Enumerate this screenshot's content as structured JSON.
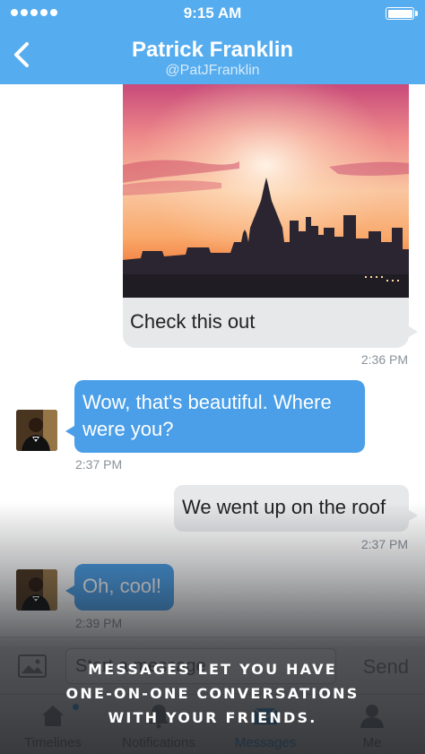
{
  "status_bar": {
    "time": "9:15 AM",
    "signal_dots": 5,
    "battery_level": 1.0
  },
  "header": {
    "title": "Patrick Franklin",
    "handle": "@PatJFranklin"
  },
  "messages": [
    {
      "direction": "outgoing",
      "type": "photo",
      "caption": "Check this out",
      "time": "2:36 PM"
    },
    {
      "direction": "incoming",
      "type": "text",
      "lines": [
        "Wow, that's beautiful. Where",
        "were you?"
      ],
      "time": "2:37 PM"
    },
    {
      "direction": "outgoing",
      "type": "text",
      "text": "We went up on the roof",
      "time": "2:37 PM"
    },
    {
      "direction": "incoming",
      "type": "text",
      "text": "Oh, cool!",
      "time": "2:39 PM"
    }
  ],
  "compose": {
    "placeholder": "Start a message",
    "send_label": "Send",
    "icon": "camera-icon"
  },
  "tabs": [
    {
      "label": "Timelines",
      "icon": "home-icon",
      "active": false,
      "has_notification_dot": true
    },
    {
      "label": "Notifications",
      "icon": "bell-icon",
      "active": false
    },
    {
      "label": "Messages",
      "icon": "envelope-icon",
      "active": true
    },
    {
      "label": "Me",
      "icon": "person-icon",
      "active": false
    }
  ],
  "promo": {
    "lines": [
      "MESSAGES LET YOU HAVE",
      "ONE-ON-ONE CONVERSATIONS",
      "WITH YOUR FRIENDS."
    ]
  },
  "colors": {
    "accent": "#55acee",
    "incoming_bubble": "#4a9fe8",
    "outgoing_bubble": "#e6e8ea",
    "timestamp": "#8a9299"
  }
}
